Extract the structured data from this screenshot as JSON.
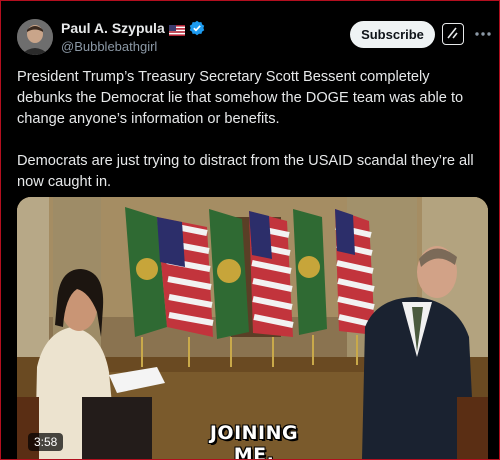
{
  "author": {
    "display_name": "Paul A. Szypula",
    "handle": "@Bubblebathgirl",
    "flag_icon": "us-flag-icon",
    "verified_icon": "verified-badge-icon",
    "verified_color": "#1d9bf0"
  },
  "actions": {
    "subscribe_label": "Subscribe",
    "grok_icon": "grok-icon",
    "more_icon": "more-options-icon"
  },
  "post": {
    "text": "President Trump’s Treasury Secretary Scott Bessent completely debunks the Democrat lie that somehow the DOGE team was able to change anyone’s information or benefits.\n\nDemocrats are just trying to distract from the USAID scandal they’re all now caught in."
  },
  "video": {
    "caption": "JOINING ME.",
    "duration": "3:58"
  },
  "colors": {
    "background": "#000000",
    "frame_border": "#b30f1f",
    "subscribe_bg": "#eff3f4",
    "handle": "#8b98a5"
  }
}
